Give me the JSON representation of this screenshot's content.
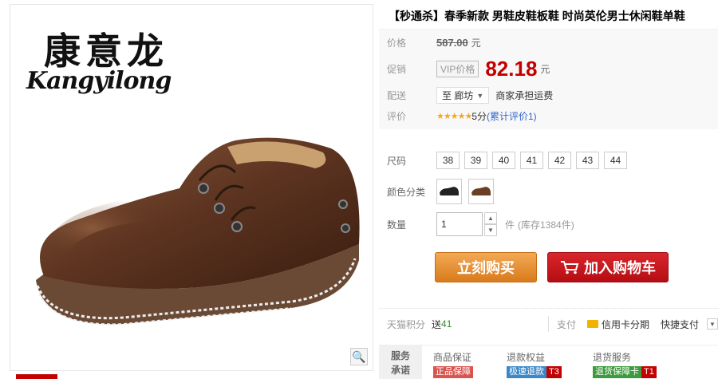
{
  "gallery": {
    "brand_cn": "康意龙",
    "brand_en": "Kangyilong",
    "zoom_icon": "magnifier-icon"
  },
  "product": {
    "title": "【秒通杀】春季新款 男鞋皮鞋板鞋 时尚英伦男士休闲鞋单鞋"
  },
  "pricing": {
    "original_label": "价格",
    "original_price": "587.00",
    "currency": "元",
    "promo_label": "促销",
    "vip_tag": "VIP价格",
    "promo_price": "82.18",
    "delivery_label": "配送",
    "delivery_to": "至 廊坊",
    "freight": "商家承担运费",
    "rating_label": "评价",
    "stars": "★★★★★",
    "rating_text": "5分",
    "rating_link": "(累计评价1)"
  },
  "sku": {
    "size_label": "尺码",
    "sizes": [
      "38",
      "39",
      "40",
      "41",
      "42",
      "43",
      "44"
    ],
    "color_label": "颜色分类",
    "qty_label": "数量",
    "qty_value": "1",
    "qty_unit": "件",
    "stock": "(库存1384件)"
  },
  "actions": {
    "buy_now": "立刻购买",
    "add_cart": "加入购物车"
  },
  "footer": {
    "points_label": "天猫积分",
    "points_text": "送",
    "points_value": "41",
    "pay_label": "支付",
    "credit": "信用卡分期",
    "quick_pay": "快捷支付"
  },
  "service": {
    "label_line1": "服务",
    "label_line2": "承诺",
    "col1_title": "商品保证",
    "col1_badge": "正品保障",
    "col2_title": "退款权益",
    "col2_badge": "极速退款",
    "col2_suffix": "T3",
    "col3_title": "退货服务",
    "col3_badge": "退货保障卡",
    "col3_suffix": "T1"
  },
  "colors": {
    "price_red": "#c40000",
    "buy_orange": "#e08a2a",
    "cart_red": "#c4161c"
  }
}
